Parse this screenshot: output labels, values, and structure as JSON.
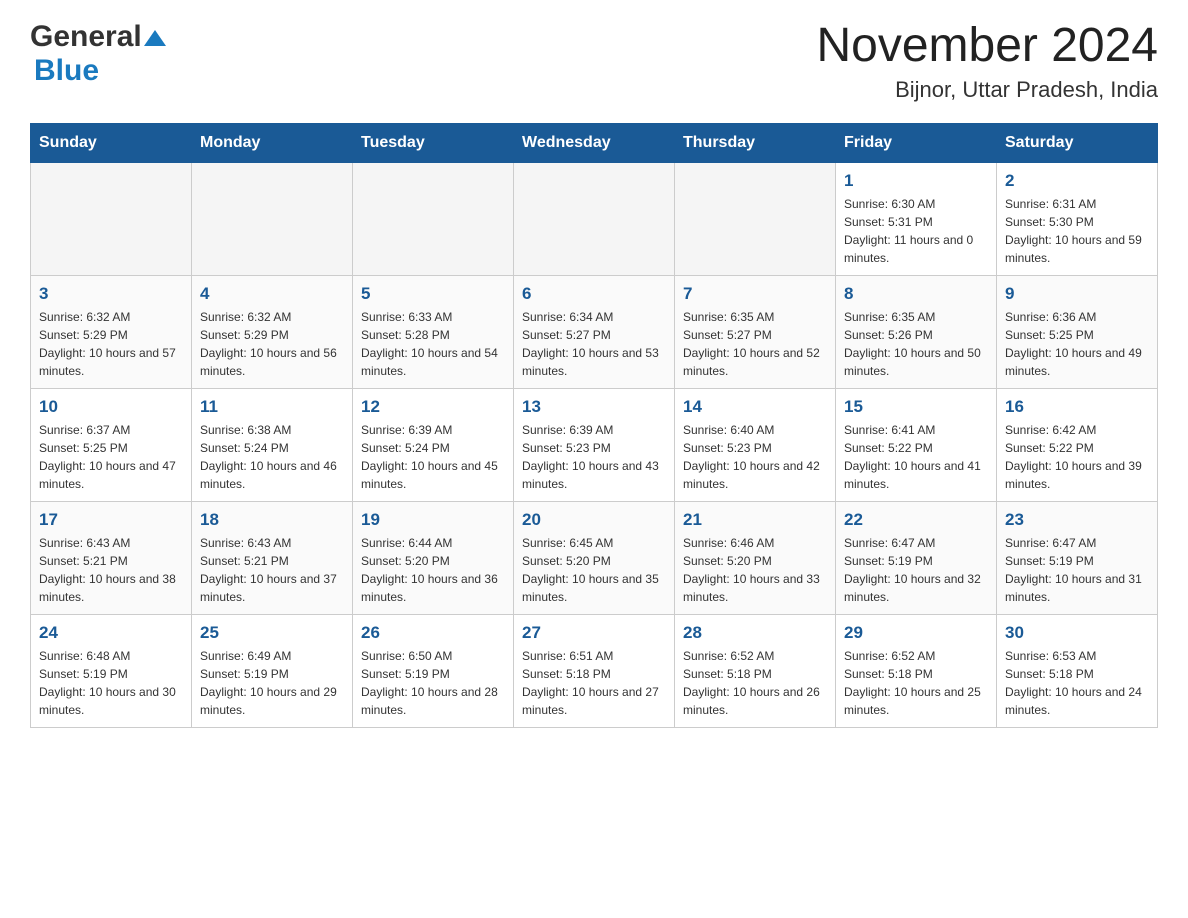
{
  "header": {
    "logo_general": "General",
    "logo_blue": "Blue",
    "title": "November 2024",
    "subtitle": "Bijnor, Uttar Pradesh, India"
  },
  "days_of_week": [
    "Sunday",
    "Monday",
    "Tuesday",
    "Wednesday",
    "Thursday",
    "Friday",
    "Saturday"
  ],
  "weeks": [
    [
      {
        "day": "",
        "info": ""
      },
      {
        "day": "",
        "info": ""
      },
      {
        "day": "",
        "info": ""
      },
      {
        "day": "",
        "info": ""
      },
      {
        "day": "",
        "info": ""
      },
      {
        "day": "1",
        "info": "Sunrise: 6:30 AM\nSunset: 5:31 PM\nDaylight: 11 hours and 0 minutes."
      },
      {
        "day": "2",
        "info": "Sunrise: 6:31 AM\nSunset: 5:30 PM\nDaylight: 10 hours and 59 minutes."
      }
    ],
    [
      {
        "day": "3",
        "info": "Sunrise: 6:32 AM\nSunset: 5:29 PM\nDaylight: 10 hours and 57 minutes."
      },
      {
        "day": "4",
        "info": "Sunrise: 6:32 AM\nSunset: 5:29 PM\nDaylight: 10 hours and 56 minutes."
      },
      {
        "day": "5",
        "info": "Sunrise: 6:33 AM\nSunset: 5:28 PM\nDaylight: 10 hours and 54 minutes."
      },
      {
        "day": "6",
        "info": "Sunrise: 6:34 AM\nSunset: 5:27 PM\nDaylight: 10 hours and 53 minutes."
      },
      {
        "day": "7",
        "info": "Sunrise: 6:35 AM\nSunset: 5:27 PM\nDaylight: 10 hours and 52 minutes."
      },
      {
        "day": "8",
        "info": "Sunrise: 6:35 AM\nSunset: 5:26 PM\nDaylight: 10 hours and 50 minutes."
      },
      {
        "day": "9",
        "info": "Sunrise: 6:36 AM\nSunset: 5:25 PM\nDaylight: 10 hours and 49 minutes."
      }
    ],
    [
      {
        "day": "10",
        "info": "Sunrise: 6:37 AM\nSunset: 5:25 PM\nDaylight: 10 hours and 47 minutes."
      },
      {
        "day": "11",
        "info": "Sunrise: 6:38 AM\nSunset: 5:24 PM\nDaylight: 10 hours and 46 minutes."
      },
      {
        "day": "12",
        "info": "Sunrise: 6:39 AM\nSunset: 5:24 PM\nDaylight: 10 hours and 45 minutes."
      },
      {
        "day": "13",
        "info": "Sunrise: 6:39 AM\nSunset: 5:23 PM\nDaylight: 10 hours and 43 minutes."
      },
      {
        "day": "14",
        "info": "Sunrise: 6:40 AM\nSunset: 5:23 PM\nDaylight: 10 hours and 42 minutes."
      },
      {
        "day": "15",
        "info": "Sunrise: 6:41 AM\nSunset: 5:22 PM\nDaylight: 10 hours and 41 minutes."
      },
      {
        "day": "16",
        "info": "Sunrise: 6:42 AM\nSunset: 5:22 PM\nDaylight: 10 hours and 39 minutes."
      }
    ],
    [
      {
        "day": "17",
        "info": "Sunrise: 6:43 AM\nSunset: 5:21 PM\nDaylight: 10 hours and 38 minutes."
      },
      {
        "day": "18",
        "info": "Sunrise: 6:43 AM\nSunset: 5:21 PM\nDaylight: 10 hours and 37 minutes."
      },
      {
        "day": "19",
        "info": "Sunrise: 6:44 AM\nSunset: 5:20 PM\nDaylight: 10 hours and 36 minutes."
      },
      {
        "day": "20",
        "info": "Sunrise: 6:45 AM\nSunset: 5:20 PM\nDaylight: 10 hours and 35 minutes."
      },
      {
        "day": "21",
        "info": "Sunrise: 6:46 AM\nSunset: 5:20 PM\nDaylight: 10 hours and 33 minutes."
      },
      {
        "day": "22",
        "info": "Sunrise: 6:47 AM\nSunset: 5:19 PM\nDaylight: 10 hours and 32 minutes."
      },
      {
        "day": "23",
        "info": "Sunrise: 6:47 AM\nSunset: 5:19 PM\nDaylight: 10 hours and 31 minutes."
      }
    ],
    [
      {
        "day": "24",
        "info": "Sunrise: 6:48 AM\nSunset: 5:19 PM\nDaylight: 10 hours and 30 minutes."
      },
      {
        "day": "25",
        "info": "Sunrise: 6:49 AM\nSunset: 5:19 PM\nDaylight: 10 hours and 29 minutes."
      },
      {
        "day": "26",
        "info": "Sunrise: 6:50 AM\nSunset: 5:19 PM\nDaylight: 10 hours and 28 minutes."
      },
      {
        "day": "27",
        "info": "Sunrise: 6:51 AM\nSunset: 5:18 PM\nDaylight: 10 hours and 27 minutes."
      },
      {
        "day": "28",
        "info": "Sunrise: 6:52 AM\nSunset: 5:18 PM\nDaylight: 10 hours and 26 minutes."
      },
      {
        "day": "29",
        "info": "Sunrise: 6:52 AM\nSunset: 5:18 PM\nDaylight: 10 hours and 25 minutes."
      },
      {
        "day": "30",
        "info": "Sunrise: 6:53 AM\nSunset: 5:18 PM\nDaylight: 10 hours and 24 minutes."
      }
    ]
  ]
}
